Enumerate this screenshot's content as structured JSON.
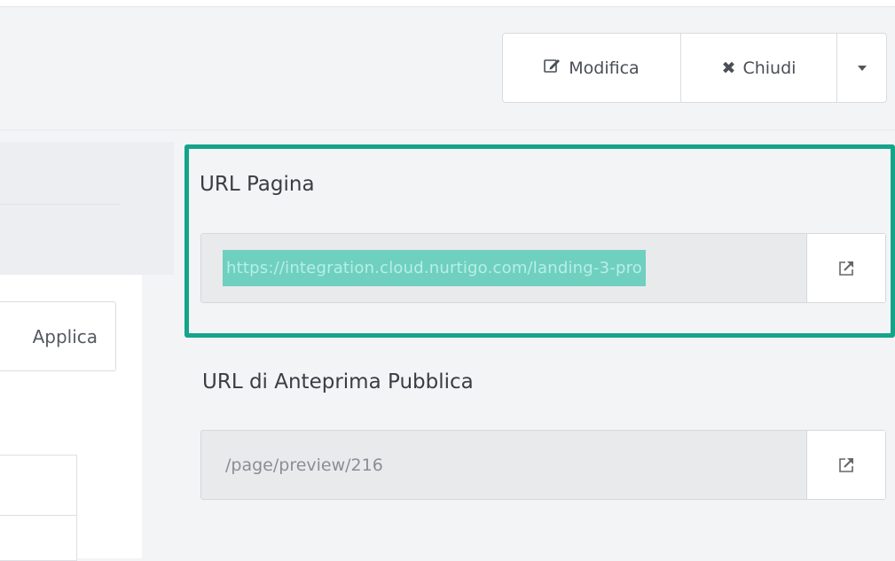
{
  "toolbar": {
    "edit_label": "Modifica",
    "close_label": "Chiudi"
  },
  "left": {
    "apply_label": "Applica"
  },
  "page_url": {
    "label": "URL Pagina",
    "value": "https://integration.cloud.nurtigo.com/landing-3-pro"
  },
  "preview_url": {
    "label": "URL di Anteprima Pubblica",
    "value": "/page/preview/216"
  },
  "colors": {
    "highlight": "#14a48a",
    "selection": "#6fd0c0"
  },
  "icons": [
    "edit-icon",
    "close-icon",
    "chevron-down-icon",
    "external-link-icon"
  ]
}
